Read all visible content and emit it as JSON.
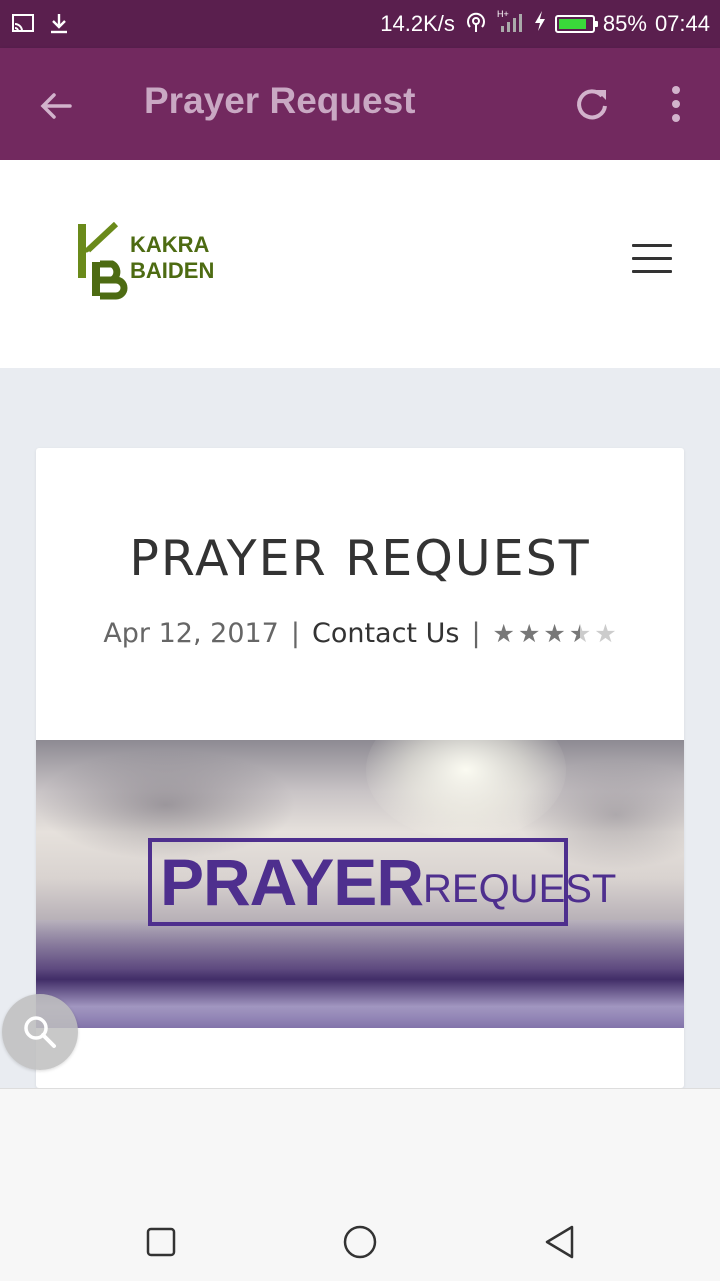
{
  "status_bar": {
    "net_speed": "14.2K/s",
    "battery": "85%",
    "battery_level": 0.85,
    "time": "07:44",
    "icons": [
      "cast-icon",
      "download-icon",
      "hotspot-icon",
      "signal-icon",
      "charging-icon"
    ],
    "battery_color": "#3ad93a"
  },
  "app_bar": {
    "title": "Prayer Request",
    "color": "#72295f",
    "icons": [
      "back-arrow-icon",
      "reload-icon",
      "more-vert-icon"
    ]
  },
  "site_header": {
    "logo_monogram": "KB",
    "logo_line1": "KAKRA",
    "logo_line2": "BAIDEN",
    "logo_color": "#4d6b12",
    "menu_icon": "hamburger-menu-icon"
  },
  "post": {
    "title": "PRAYER REQUEST",
    "date": "Apr 12, 2017",
    "separator": "|",
    "category": "Contact Us",
    "rating": 3.5,
    "rating_max": 5,
    "banner": {
      "word_bold": "PRAYER",
      "word_light": "REQUEST",
      "text_color": "#4e2f8e"
    }
  },
  "floating": {
    "search_icon": "search-icon"
  },
  "nav_bar": {
    "icons": [
      "recents-square-icon",
      "home-circle-icon",
      "back-triangle-icon"
    ]
  }
}
